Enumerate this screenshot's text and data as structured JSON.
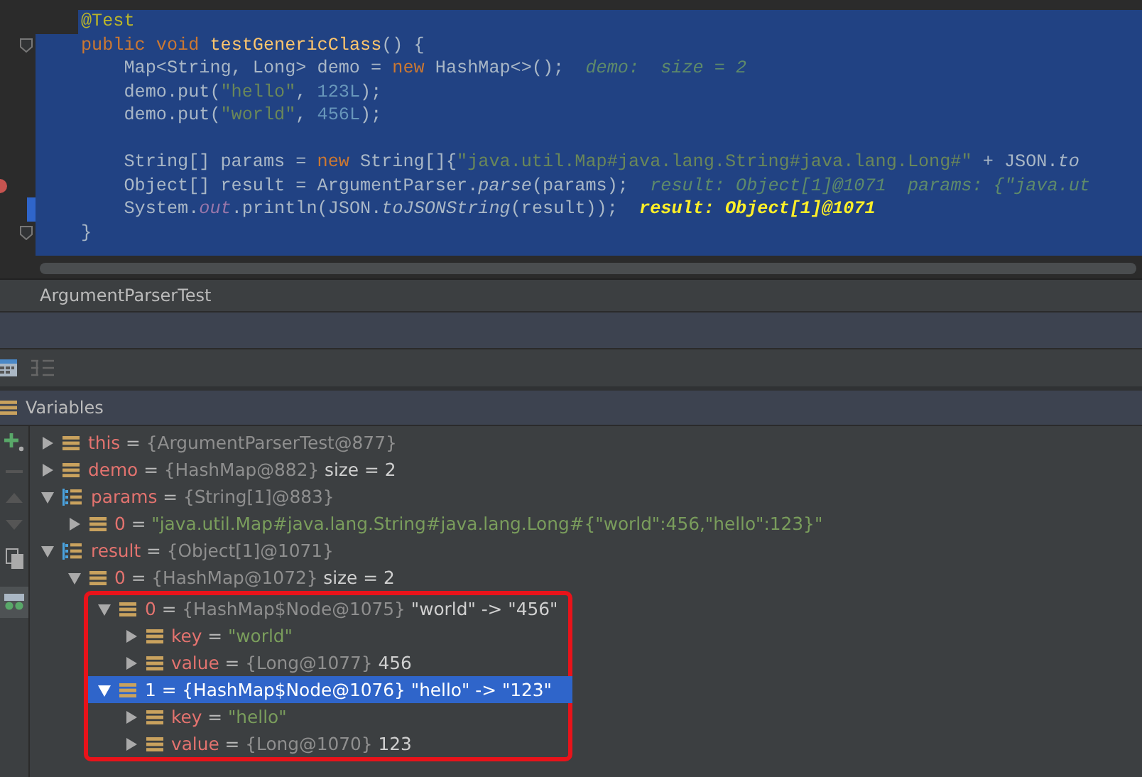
{
  "editor": {
    "lines": [
      {
        "kind": "code",
        "first": true,
        "tokens": [
          {
            "kind": "ann",
            "text": "@Test"
          }
        ]
      },
      {
        "kind": "code",
        "fold": true,
        "tokens": [
          {
            "kind": "kw",
            "text": "public void "
          },
          {
            "kind": "fn",
            "text": "testGenericClass"
          },
          {
            "kind": "plain",
            "text": "() {"
          }
        ]
      },
      {
        "kind": "code",
        "tokens": [
          {
            "kind": "plain",
            "text": "    Map<String, Long> demo = "
          },
          {
            "kind": "kw",
            "text": "new "
          },
          {
            "kind": "plain",
            "text": "HashMap<>();"
          },
          {
            "kind": "hint",
            "text": "  demo:  size = 2"
          }
        ]
      },
      {
        "kind": "code",
        "tokens": [
          {
            "kind": "plain",
            "text": "    demo.put("
          },
          {
            "kind": "str",
            "text": "\"hello\""
          },
          {
            "kind": "plain",
            "text": ", "
          },
          {
            "kind": "num",
            "text": "123L"
          },
          {
            "kind": "plain",
            "text": ");"
          }
        ]
      },
      {
        "kind": "code",
        "tokens": [
          {
            "kind": "plain",
            "text": "    demo.put("
          },
          {
            "kind": "str",
            "text": "\"world\""
          },
          {
            "kind": "plain",
            "text": ", "
          },
          {
            "kind": "num",
            "text": "456L"
          },
          {
            "kind": "plain",
            "text": ");"
          }
        ]
      },
      {
        "kind": "blank"
      },
      {
        "kind": "code",
        "tokens": [
          {
            "kind": "plain",
            "text": "    String[] params = "
          },
          {
            "kind": "kw",
            "text": "new "
          },
          {
            "kind": "plain",
            "text": "String[]{"
          },
          {
            "kind": "str",
            "text": "\"java.util.Map#java.lang.String#java.lang.Long#\""
          },
          {
            "kind": "plain",
            "text": " + JSON."
          },
          {
            "kind": "italic",
            "text": "to"
          }
        ]
      },
      {
        "kind": "code",
        "breakpoint": true,
        "tokens": [
          {
            "kind": "plain",
            "text": "    Object[] result = ArgumentParser."
          },
          {
            "kind": "italic",
            "text": "parse"
          },
          {
            "kind": "plain",
            "text": "(params);"
          },
          {
            "kind": "hint",
            "text": "  result: Object[1]@1071  params: {\"java.ut"
          }
        ]
      },
      {
        "kind": "code",
        "current": true,
        "tokens": [
          {
            "kind": "plain",
            "text": "    System."
          },
          {
            "kind": "field",
            "text": "out"
          },
          {
            "kind": "plain",
            "text": ".println(JSON."
          },
          {
            "kind": "italic",
            "text": "toJSONString"
          },
          {
            "kind": "plain",
            "text": "(result));"
          },
          {
            "kind": "hint_bold",
            "text": "  result: Object[1]@1071"
          }
        ]
      },
      {
        "kind": "code",
        "fold": true,
        "tokens": [
          {
            "kind": "plain",
            "text": "}"
          }
        ]
      }
    ]
  },
  "tab": {
    "label": "ArgumentParserTest"
  },
  "variables": {
    "title": "Variables",
    "nodes": [
      {
        "kind": "field",
        "expanded": false,
        "selected": false,
        "name": "this",
        "parts": [
          {
            "kind": "op",
            "text": "="
          },
          {
            "kind": "ref",
            "text": "{ArgumentParserTest@877}"
          }
        ]
      },
      {
        "kind": "field",
        "expanded": false,
        "selected": false,
        "name": "demo",
        "parts": [
          {
            "kind": "op",
            "text": "="
          },
          {
            "kind": "ref",
            "text": "{HashMap@882}"
          },
          {
            "kind": "text",
            "text": "size = 2"
          }
        ]
      },
      {
        "kind": "array",
        "expanded": true,
        "selected": false,
        "name": "params",
        "parts": [
          {
            "kind": "op",
            "text": "="
          },
          {
            "kind": "ref",
            "text": "{String[1]@883}"
          }
        ],
        "children": [
          {
            "kind": "field",
            "expanded": false,
            "selected": false,
            "name": "0",
            "parts": [
              {
                "kind": "op",
                "text": "="
              },
              {
                "kind": "str",
                "text": "\"java.util.Map#java.lang.String#java.lang.Long#{\"world\":456,\"hello\":123}\""
              }
            ]
          }
        ]
      },
      {
        "kind": "array",
        "expanded": true,
        "selected": false,
        "name": "result",
        "parts": [
          {
            "kind": "op",
            "text": "="
          },
          {
            "kind": "ref",
            "text": "{Object[1]@1071}"
          }
        ],
        "children": [
          {
            "kind": "field",
            "expanded": true,
            "selected": false,
            "outlined": true,
            "name": "0",
            "parts": [
              {
                "kind": "op",
                "text": "="
              },
              {
                "kind": "ref",
                "text": "{HashMap@1072}"
              },
              {
                "kind": "text",
                "text": "size = 2"
              }
            ],
            "children": [
              {
                "kind": "field",
                "expanded": true,
                "selected": false,
                "name": "0",
                "parts": [
                  {
                    "kind": "op",
                    "text": "="
                  },
                  {
                    "kind": "ref",
                    "text": "{HashMap$Node@1075}"
                  },
                  {
                    "kind": "text",
                    "text": "\"world\" -> \"456\""
                  }
                ],
                "children": [
                  {
                    "kind": "field",
                    "expanded": false,
                    "selected": false,
                    "name": "key",
                    "parts": [
                      {
                        "kind": "op",
                        "text": "="
                      },
                      {
                        "kind": "str",
                        "text": "\"world\""
                      }
                    ]
                  },
                  {
                    "kind": "field",
                    "expanded": false,
                    "selected": false,
                    "name": "value",
                    "parts": [
                      {
                        "kind": "op",
                        "text": "="
                      },
                      {
                        "kind": "ref",
                        "text": "{Long@1077}"
                      },
                      {
                        "kind": "text",
                        "text": "456"
                      }
                    ]
                  }
                ]
              },
              {
                "kind": "field",
                "expanded": true,
                "selected": true,
                "name": "1",
                "parts": [
                  {
                    "kind": "op",
                    "text": "="
                  },
                  {
                    "kind": "ref",
                    "text": "{HashMap$Node@1076}"
                  },
                  {
                    "kind": "text",
                    "text": "\"hello\" -> \"123\""
                  }
                ],
                "children": [
                  {
                    "kind": "field",
                    "expanded": false,
                    "selected": false,
                    "name": "key",
                    "parts": [
                      {
                        "kind": "op",
                        "text": "="
                      },
                      {
                        "kind": "str",
                        "text": "\"hello\""
                      }
                    ]
                  },
                  {
                    "kind": "field",
                    "expanded": false,
                    "selected": false,
                    "name": "value",
                    "parts": [
                      {
                        "kind": "op",
                        "text": "="
                      },
                      {
                        "kind": "ref",
                        "text": "{Long@1070}"
                      },
                      {
                        "kind": "text",
                        "text": "123"
                      }
                    ]
                  }
                ]
              }
            ]
          }
        ]
      }
    ]
  }
}
